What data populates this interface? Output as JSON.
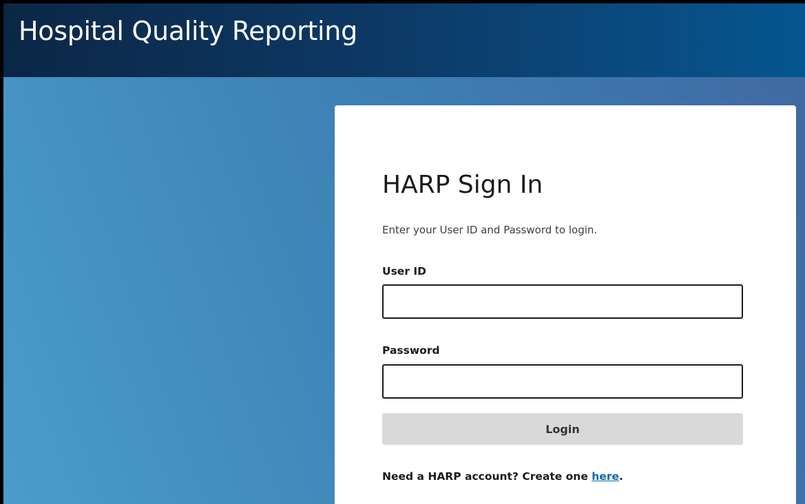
{
  "header": {
    "title": "Hospital Quality Reporting"
  },
  "signin": {
    "title": "HARP Sign In",
    "subtitle": "Enter your User ID and Password to login.",
    "user_id": {
      "label": "User ID",
      "value": ""
    },
    "password": {
      "label": "Password",
      "value": ""
    },
    "login_label": "Login",
    "account_prompt": "Need a HARP account? Create one ",
    "account_link": "here",
    "account_suffix": "."
  },
  "colors": {
    "header_bg": "#0d3864",
    "page_bg": "#3f86b8",
    "link": "#0b6aa8",
    "button_bg": "#d9d9da"
  }
}
